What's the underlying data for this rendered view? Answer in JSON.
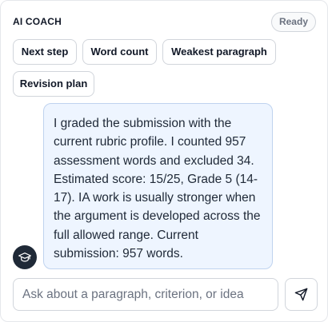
{
  "header": {
    "title": "AI COACH",
    "status": "Ready"
  },
  "chips": [
    {
      "label": "Next step"
    },
    {
      "label": "Word count"
    },
    {
      "label": "Weakest paragraph"
    },
    {
      "label": "Revision plan"
    }
  ],
  "messages": [
    {
      "role": "assistant",
      "avatar_icon": "graduation-cap-icon",
      "text": "I graded the submission with the current rubric profile. I counted 957 assessment words and excluded 34. Estimated score: 15/25, Grade 5 (14-17). IA work is usually stronger when the argument is developed across the full allowed range. Current submission: 957 words."
    }
  ],
  "composer": {
    "value": "",
    "placeholder": "Ask about a paragraph, criterion, or idea",
    "send_icon": "send-icon"
  },
  "colors": {
    "bubble_bg": "#eef5ff",
    "bubble_border": "#bfd3ef",
    "avatar_bg": "#1f2937"
  }
}
